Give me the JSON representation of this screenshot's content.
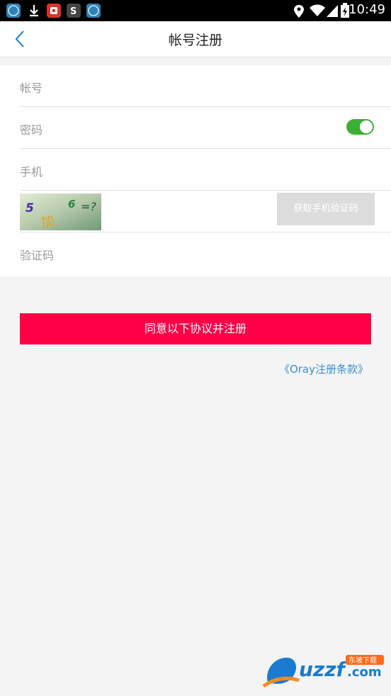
{
  "status_bar": {
    "time": "10:49",
    "notification_icons": [
      "vpn-app-icon",
      "download-icon",
      "shield-app-icon",
      "s-app-icon",
      "vpn-app-icon"
    ],
    "system_icons": [
      "location-icon",
      "wifi-icon",
      "signal-icon",
      "battery-charging-icon"
    ]
  },
  "header": {
    "title": "帐号注册",
    "back_icon": "chevron-left-icon"
  },
  "form": {
    "account_placeholder": "帐号",
    "password_placeholder": "密码",
    "password_visible": true,
    "phone_placeholder": "手机",
    "captcha_text": "5 加 6 =?",
    "sms_button_label": "获取手机验证码",
    "code_placeholder": "验证码"
  },
  "actions": {
    "submit_label": "同意以下协议并注册",
    "terms_link": "《Oray注册条款》"
  },
  "colors": {
    "accent": "#ff0046",
    "toggle_on": "#3cb034",
    "link": "#3a8fd0"
  },
  "watermark": {
    "brand": "uzzf.com",
    "tagline": "东坡下载"
  }
}
